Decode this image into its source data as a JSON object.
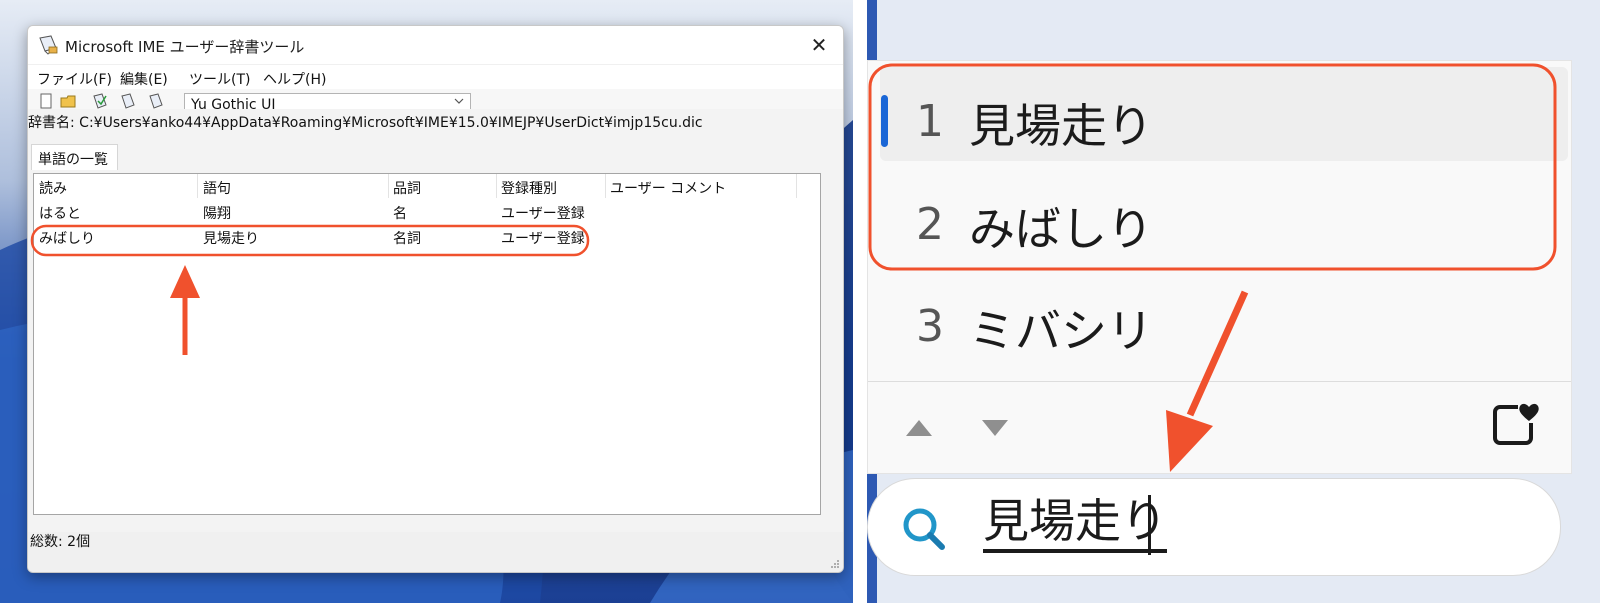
{
  "left": {
    "window": {
      "title": "Microsoft IME ユーザー辞書ツール",
      "close_glyph": "✕"
    },
    "menu": [
      "ファイル(F)",
      "編集(E)",
      "ツール(T)",
      "ヘルプ(H)"
    ],
    "toolbar": {
      "font_value": "Yu Gothic UI"
    },
    "dict_path": "辞書名: C:¥Users¥anko44¥AppData¥Roaming¥Microsoft¥IME¥15.0¥IMEJP¥UserDict¥imjp15cu.dic",
    "tab_label": "単語の一覧",
    "columns": [
      "読み",
      "語句",
      "品詞",
      "登録種別",
      "ユーザー コメント"
    ],
    "rows": [
      [
        "はると",
        "陽翔",
        "名",
        "ユーザー登録",
        ""
      ],
      [
        "みばしり",
        "見場走り",
        "名詞",
        "ユーザー登録",
        ""
      ]
    ],
    "status": "総数: 2個"
  },
  "right": {
    "candidates": [
      {
        "num": "1",
        "text": "見場走り",
        "selected": true
      },
      {
        "num": "2",
        "text": "みばしり",
        "selected": false
      },
      {
        "num": "3",
        "text": "ミバシリ",
        "selected": false
      }
    ],
    "search_text": "見場走り"
  },
  "colors": {
    "annotation": "#f0512d",
    "selection": "#1a66d6",
    "search_icon": "#2196c9"
  }
}
